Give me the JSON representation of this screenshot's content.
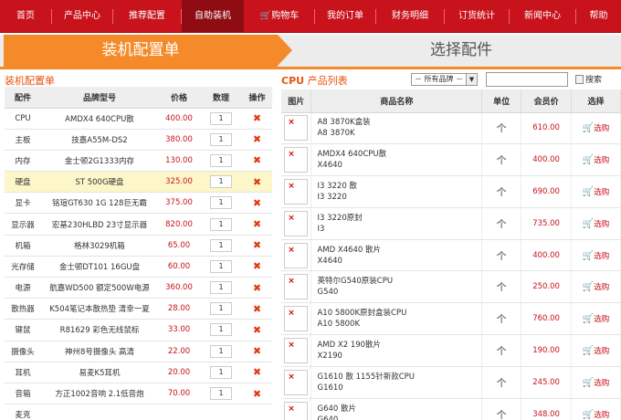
{
  "nav": [
    {
      "label": "首页"
    },
    {
      "label": "产品中心"
    },
    {
      "label": "推荐配置"
    },
    {
      "label": "自助装机"
    },
    {
      "label": "购物车",
      "icon": "cart-icon"
    },
    {
      "label": "我的订单"
    },
    {
      "label": "财务明细"
    },
    {
      "label": "订货统计"
    },
    {
      "label": "新闻中心"
    },
    {
      "label": "帮助"
    }
  ],
  "steps": {
    "active": "装机配置单",
    "next": "选择配件"
  },
  "config": {
    "title": "装机配置单",
    "headers": [
      "配件",
      "品牌型号",
      "价格",
      "数理",
      "操作"
    ],
    "rows": [
      {
        "part": "CPU",
        "model": "AMDX4 640CPU散",
        "price": "400.00",
        "qty": "1"
      },
      {
        "part": "主板",
        "model": "技嘉A55M-DS2",
        "price": "380.00",
        "qty": "1"
      },
      {
        "part": "内存",
        "model": "金士顿2G1333内存",
        "price": "130.00",
        "qty": "1"
      },
      {
        "part": "硬盘",
        "model": "ST 500G硬盘",
        "price": "325.00",
        "qty": "1"
      },
      {
        "part": "显卡",
        "model": "铭瑄GT630 1G 128巨无霸",
        "price": "375.00",
        "qty": "1"
      },
      {
        "part": "显示器",
        "model": "宏基230HLBD 23寸显示器",
        "price": "820.00",
        "qty": "1"
      },
      {
        "part": "机箱",
        "model": "格林3029机箱",
        "price": "65.00",
        "qty": "1"
      },
      {
        "part": "光存储",
        "model": "金士顿DT101 16GU盘",
        "price": "60.00",
        "qty": "1"
      },
      {
        "part": "电源",
        "model": "航嘉WD500 额定500W电源",
        "price": "360.00",
        "qty": "1"
      },
      {
        "part": "散热器",
        "model": "K504笔记本散热垫 清幸一夏",
        "price": "28.00",
        "qty": "1"
      },
      {
        "part": "键鼠",
        "model": "R81629 彩色无线鼠标",
        "price": "33.00",
        "qty": "1"
      },
      {
        "part": "摄像头",
        "model": "神州8号摄像头 高清",
        "price": "22.00",
        "qty": "1"
      },
      {
        "part": "耳机",
        "model": "易麦K5耳机",
        "price": "20.00",
        "qty": "1"
      },
      {
        "part": "音箱",
        "model": "方正1002音响 2.1低音炮",
        "price": "70.00",
        "qty": "1"
      },
      {
        "part": "麦克",
        "model": "",
        "price": "",
        "qty": ""
      }
    ]
  },
  "products": {
    "title_prefix": "CPU",
    "title": "产品列表",
    "brand_filter": "－ 所有品牌 －",
    "search_value": "",
    "search_label": "搜索",
    "headers": [
      "图片",
      "商品名称",
      "单位",
      "会员价",
      "选择"
    ],
    "select_label": "选购",
    "unit": "个",
    "rows": [
      {
        "name1": "A8 3870K盒装",
        "name2": "A8 3870K",
        "price": "610.00"
      },
      {
        "name1": "AMDX4 640CPU散",
        "name2": "X4640",
        "price": "400.00"
      },
      {
        "name1": "I3 3220 散",
        "name2": "I3 3220",
        "price": "690.00"
      },
      {
        "name1": "I3 3220原封",
        "name2": "I3",
        "price": "735.00"
      },
      {
        "name1": "AMD X4640 散片",
        "name2": "X4640",
        "price": "400.00"
      },
      {
        "name1": "英特尔G540原装CPU",
        "name2": "G540",
        "price": "250.00"
      },
      {
        "name1": "A10 5800K原封盒装CPU",
        "name2": "A10 5800K",
        "price": "760.00"
      },
      {
        "name1": "AMD X2 190散片",
        "name2": "X2190",
        "price": "190.00"
      },
      {
        "name1": "G1610 散 1155针新款CPU",
        "name2": "G1610",
        "price": "245.00"
      },
      {
        "name1": "G640 散片",
        "name2": "G640",
        "price": "348.00"
      }
    ]
  },
  "colors": {
    "brand_red": "#c8121c",
    "accent_orange": "#f48a2a",
    "highlight_row": "#fdf6c8"
  }
}
